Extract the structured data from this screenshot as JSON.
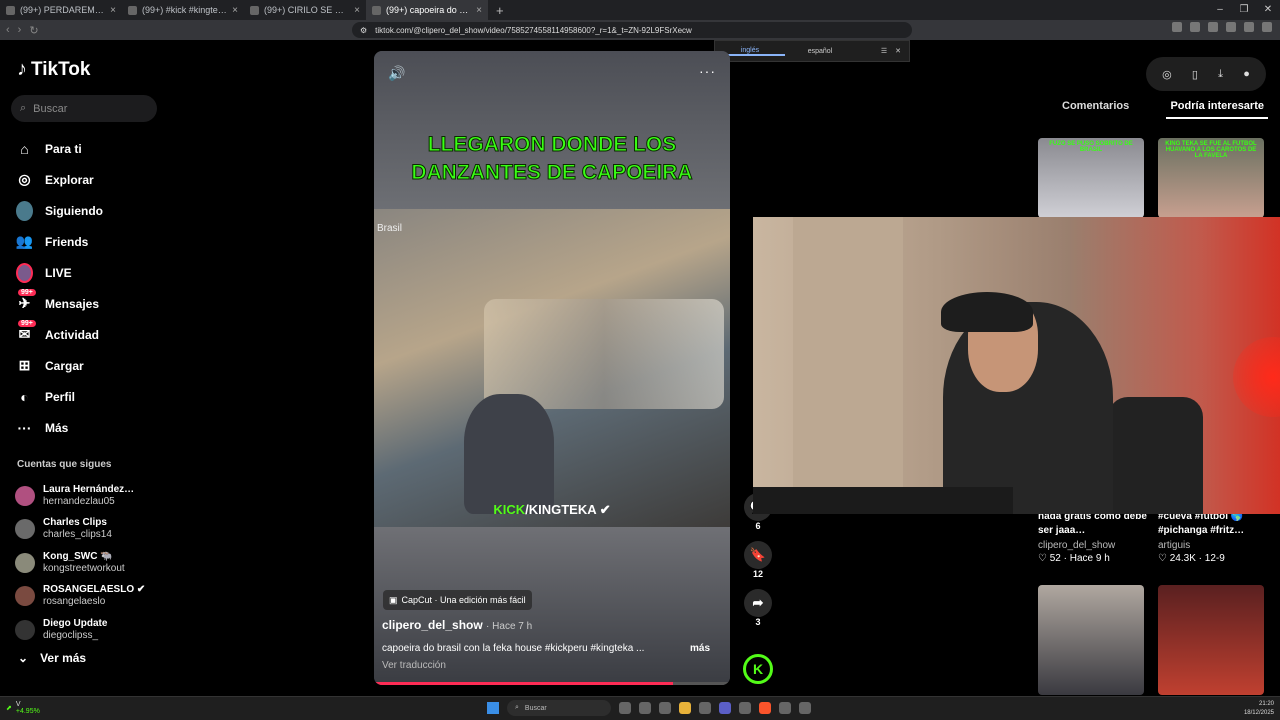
{
  "browser": {
    "tabs": [
      {
        "label": "(99+) PERDAREMAST ● (@piensare…",
        "active": false
      },
      {
        "label": "(99+) #kick #kingtekadota #kingteka…",
        "active": false
      },
      {
        "label": "(99+) CIRILO SE MOLESTA CON PNC…",
        "active": false
      },
      {
        "label": "(99+) capoeira do brasil con la f…",
        "active": true
      }
    ],
    "new_tab": "+",
    "url": "tiktok.com/@clipero_del_show/video/7585274558114958600?_r=1&_t=ZN-92L9FSrXecw",
    "window_controls": [
      "–",
      "❐",
      "✕"
    ],
    "translate": {
      "lang1": "inglés",
      "lang2": "español"
    }
  },
  "sidebar": {
    "logo": "TikTok",
    "search_placeholder": "Buscar",
    "menu": [
      {
        "label": "Para ti",
        "icon": "home-icon",
        "glyph": "⌂",
        "badge": ""
      },
      {
        "label": "Explorar",
        "icon": "compass-icon",
        "glyph": "◎",
        "badge": ""
      },
      {
        "label": "Siguiendo",
        "icon": "following-avatar-icon",
        "glyph": "",
        "badge": ""
      },
      {
        "label": "Friends",
        "icon": "friends-icon",
        "glyph": "👥",
        "badge": ""
      },
      {
        "label": "LIVE",
        "icon": "live-avatar-icon",
        "glyph": "",
        "badge": ""
      },
      {
        "label": "Mensajes",
        "icon": "messages-icon",
        "glyph": "✈",
        "badge": "99+"
      },
      {
        "label": "Actividad",
        "icon": "activity-icon",
        "glyph": "✉",
        "badge": "99+"
      },
      {
        "label": "Cargar",
        "icon": "upload-icon",
        "glyph": "⊞",
        "badge": ""
      },
      {
        "label": "Perfil",
        "icon": "profile-icon",
        "glyph": "◐",
        "badge": ""
      },
      {
        "label": "Más",
        "icon": "more-icon",
        "glyph": "···",
        "badge": ""
      }
    ],
    "following_title": "Cuentas que sigues",
    "following": [
      {
        "name": "Laura Hernández…",
        "handle": "hernandezlau05"
      },
      {
        "name": "Charles Clips",
        "handle": "charles_clips14"
      },
      {
        "name": "Kong_SWC 🐃",
        "handle": "kongstreetworkout"
      },
      {
        "name": "ROSANGELAESLO ✔",
        "handle": "rosangelaeslo"
      },
      {
        "name": "Diego Update",
        "handle": "diegoclipss_"
      }
    ],
    "see_more": "Ver más"
  },
  "video": {
    "title_line1": "LLEGARON DONDE LOS",
    "title_line2": "DANZANTES DE CAPOEIRA",
    "location_tag": "Brasil",
    "kick_prefix": "KICK",
    "kick_suffix": "/KINGTEKA ✔",
    "capcut": "CapCut · Una edición más fácil",
    "author": "clipero_del_show",
    "time": "· Hace 7 h",
    "description": "capoeira do brasil con la feka house #kickperu #kingteka ...",
    "more": "más",
    "translate": "Ver traducción",
    "progress": 0.84
  },
  "actions": {
    "comments": "6",
    "saves": "12",
    "shares": "3",
    "kick_badge": "K"
  },
  "right_panel": {
    "tab_comments": "Comentarios",
    "tab_interest": "Podría interesarte",
    "thumb_captions": [
      "FUZO SE PUSO SOBRITO DE BRASIL",
      "KING TEKA SE FUE AL FUTBOL HUAVANO A LOS CAROTOS DE LA FAVELA"
    ],
    "cards": [
      {
        "title": "nada gratis como debe ser jaaa…",
        "author": "clipero_del_show",
        "stats": "♡ 52 · Hace 9 h"
      },
      {
        "title": "#cueva #futbol 🌎 #pichanga #fritz…",
        "author": "artiguis",
        "stats": "♡ 24.3K · 12-9"
      }
    ]
  },
  "taskbar": {
    "ticker_label": "V",
    "ticker_value": "+4.95%",
    "search": "Buscar",
    "time": "21:20",
    "date": "18/12/2025"
  }
}
